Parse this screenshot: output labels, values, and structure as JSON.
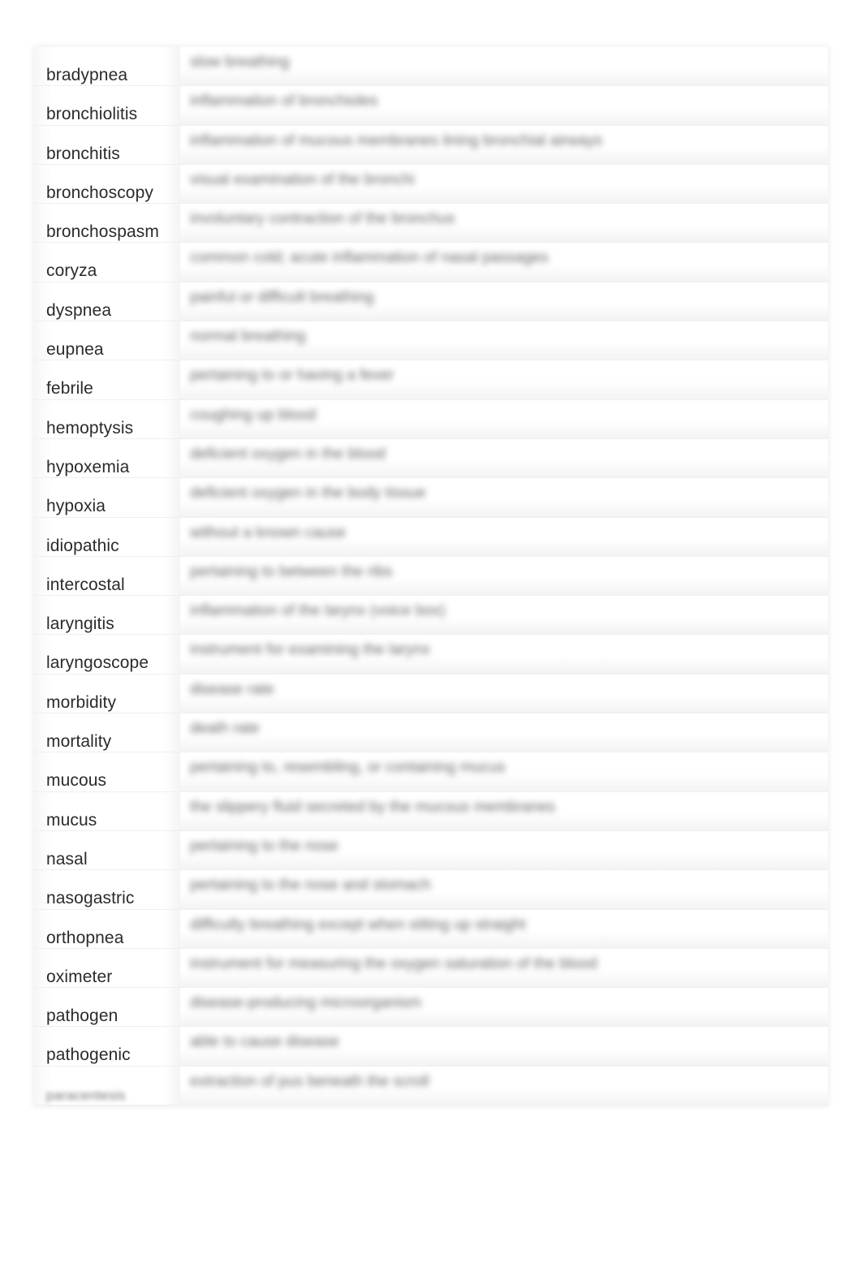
{
  "document": {
    "type": "glossary-table",
    "rows": [
      {
        "term": "bradypnea",
        "definition": "slow breathing"
      },
      {
        "term": "bronchiolitis",
        "definition": "inflammation of bronchioles"
      },
      {
        "term": "bronchitis",
        "definition": "inflammation of mucous membranes lining bronchial airways"
      },
      {
        "term": "bronchoscopy",
        "definition": "visual examination of the bronchi"
      },
      {
        "term": "bronchospasm",
        "definition": "involuntary contraction of the bronchus"
      },
      {
        "term": "coryza",
        "definition": "common cold; acute inflammation of nasal passages"
      },
      {
        "term": "dyspnea",
        "definition": "painful or difficult breathing"
      },
      {
        "term": "eupnea",
        "definition": "normal breathing"
      },
      {
        "term": "febrile",
        "definition": "pertaining to or having a fever"
      },
      {
        "term": "hemoptysis",
        "definition": "coughing up blood"
      },
      {
        "term": "hypoxemia",
        "definition": "deficient oxygen in the blood"
      },
      {
        "term": "hypoxia",
        "definition": "deficient oxygen in the body tissue"
      },
      {
        "term": "idiopathic",
        "definition": "without a known cause"
      },
      {
        "term": "intercostal",
        "definition": "pertaining to between the ribs"
      },
      {
        "term": "laryngitis",
        "definition": "inflammation of the larynx (voice box)"
      },
      {
        "term": "laryngoscope",
        "definition": "instrument for examining the larynx"
      },
      {
        "term": "morbidity",
        "definition": "disease rate"
      },
      {
        "term": "mortality",
        "definition": "death rate"
      },
      {
        "term": "mucous",
        "definition": "pertaining to, resembling, or containing mucus"
      },
      {
        "term": "mucus",
        "definition": "the slippery fluid secreted by the mucous membranes"
      },
      {
        "term": "nasal",
        "definition": "pertaining to the nose"
      },
      {
        "term": "nasogastric",
        "definition": "pertaining to the nose and stomach"
      },
      {
        "term": "orthopnea",
        "definition": "difficulty breathing except when sitting up straight"
      },
      {
        "term": "oximeter",
        "definition": "instrument for measuring the oxygen saturation of the blood"
      },
      {
        "term": "pathogen",
        "definition": "disease-producing microorganism"
      },
      {
        "term": "pathogenic",
        "definition": "able to cause disease"
      },
      {
        "term": "paracentesis",
        "definition": "extraction of pus beneath the scroll",
        "blurred_term": true
      }
    ]
  }
}
